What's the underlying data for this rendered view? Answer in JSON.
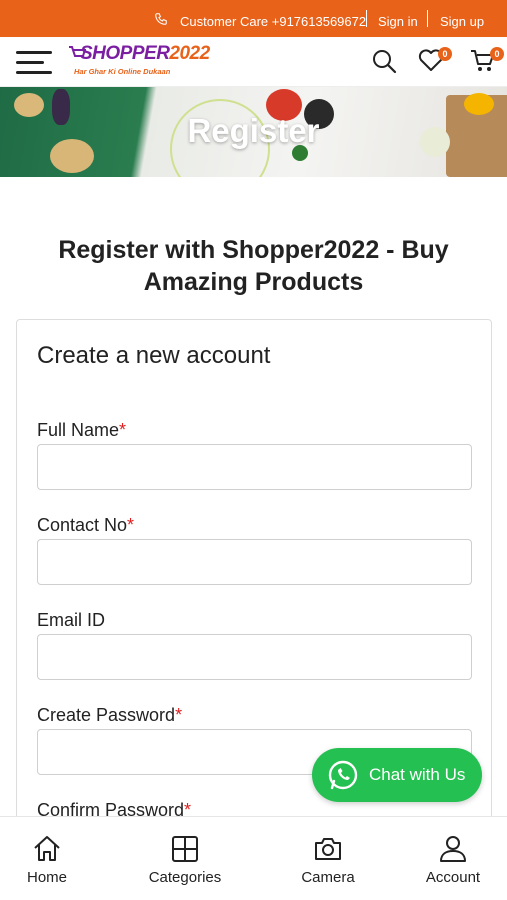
{
  "topbar": {
    "customer_care": "Customer Care +917613569672",
    "sign_in": "Sign in",
    "sign_up": "Sign up",
    "background_color": "#e8621a"
  },
  "header": {
    "logo_brand": "SHOPPER",
    "logo_year": "2022",
    "logo_tagline": "Har Ghar Ki Online Dukaan",
    "wishlist_count": "0",
    "cart_count": "0",
    "icons": [
      "menu-icon",
      "search-icon",
      "heart-icon",
      "cart-icon"
    ]
  },
  "banner": {
    "title": "Register"
  },
  "page": {
    "heading": "Register with Shopper2022 - Buy Amazing Products"
  },
  "form": {
    "title": "Create a new account",
    "required_marker": "*",
    "fields": [
      {
        "label": "Full Name",
        "required": true,
        "value": ""
      },
      {
        "label": "Contact No",
        "required": true,
        "value": ""
      },
      {
        "label": "Email ID",
        "required": false,
        "value": ""
      },
      {
        "label": "Create Password",
        "required": true,
        "value": ""
      },
      {
        "label": "Confirm Password",
        "required": true,
        "value": ""
      }
    ]
  },
  "chat": {
    "label": "Chat with Us",
    "color": "#25c052"
  },
  "bottom_nav": {
    "items": [
      {
        "label": "Home",
        "icon": "home-icon"
      },
      {
        "label": "Categories",
        "icon": "grid-icon"
      },
      {
        "label": "Camera",
        "icon": "camera-icon"
      },
      {
        "label": "Account",
        "icon": "user-icon"
      }
    ]
  }
}
